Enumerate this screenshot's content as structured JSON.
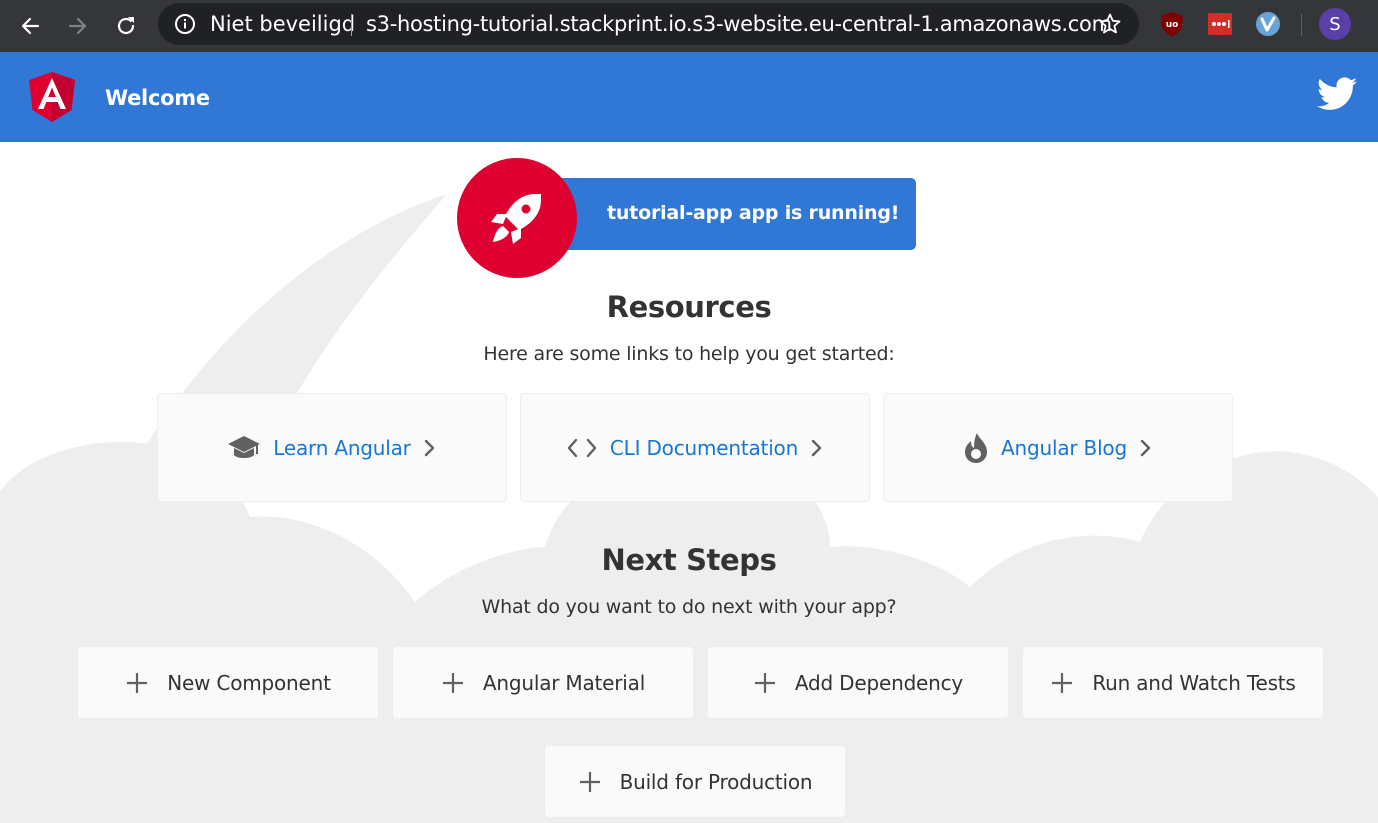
{
  "browser": {
    "security_label": "Niet beveiligd",
    "url": "s3-hosting-tutorial.stackprint.io.s3-website.eu-central-1.amazonaws.com",
    "profile_initial": "S",
    "icons": [
      "back-arrow-icon",
      "forward-arrow-icon",
      "reload-icon",
      "info-icon",
      "star-icon",
      "ublock-icon",
      "lastpass-icon",
      "vimium-icon"
    ]
  },
  "toolbar": {
    "title": "Welcome",
    "logo_icon": "angular-logo-icon",
    "social_icon": "twitter-icon",
    "color": "#3077d6"
  },
  "banner": {
    "text": "tutorial-app app is running!",
    "icon": "rocket-icon",
    "accent": "#dd0031"
  },
  "resources": {
    "heading": "Resources",
    "subheading": "Here are some links to help you get started:",
    "cards": [
      {
        "label": "Learn Angular",
        "icon": "graduation-cap-icon"
      },
      {
        "label": "CLI Documentation",
        "icon": "code-brackets-icon"
      },
      {
        "label": "Angular Blog",
        "icon": "flame-icon"
      }
    ]
  },
  "next_steps": {
    "heading": "Next Steps",
    "subheading": "What do you want to do next with your app?",
    "cards": [
      {
        "label": "New Component",
        "icon": "plus-icon"
      },
      {
        "label": "Angular Material",
        "icon": "plus-icon"
      },
      {
        "label": "Add Dependency",
        "icon": "plus-icon"
      },
      {
        "label": "Run and Watch Tests",
        "icon": "plus-icon"
      },
      {
        "label": "Build for Production",
        "icon": "plus-icon"
      }
    ]
  }
}
